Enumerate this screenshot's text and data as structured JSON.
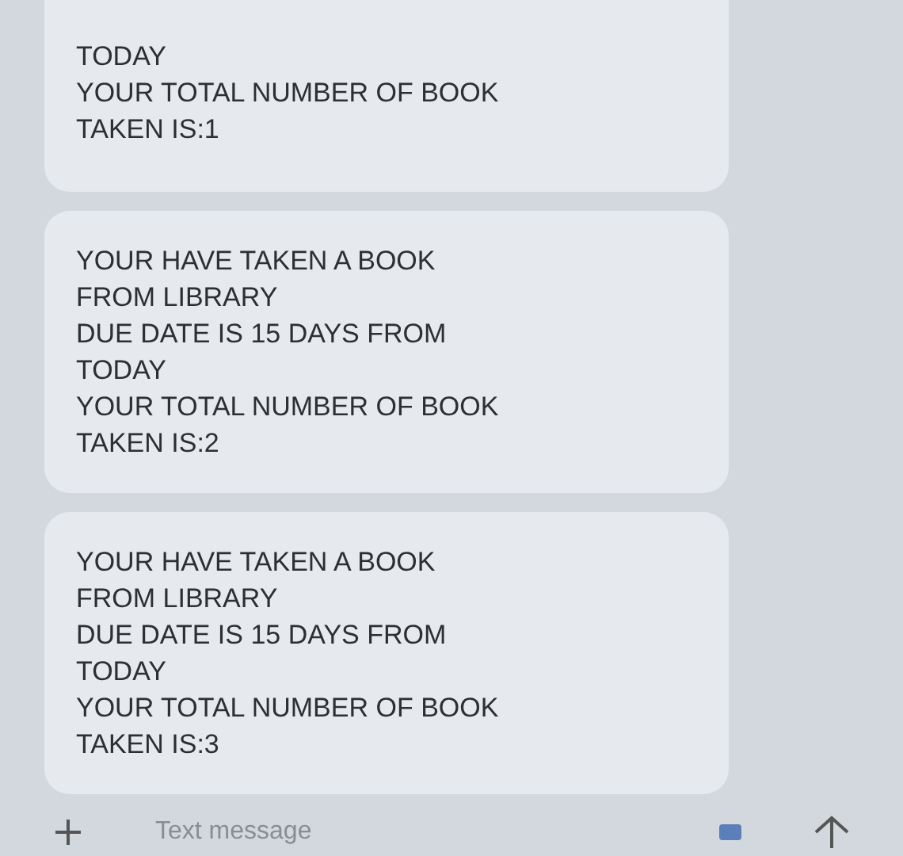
{
  "messages": [
    {
      "text": "TODAY\nYOUR TOTAL NUMBER OF BOOK\nTAKEN IS:1"
    },
    {
      "text": "YOUR HAVE TAKEN A BOOK\nFROM LIBRARY\nDUE DATE IS 15 DAYS FROM\nTODAY\nYOUR TOTAL NUMBER OF BOOK\nTAKEN IS:2"
    },
    {
      "text": "YOUR HAVE TAKEN A BOOK\nFROM LIBRARY\nDUE DATE IS 15 DAYS FROM\nTODAY\nYOUR TOTAL NUMBER OF BOOK\nTAKEN IS:3"
    }
  ],
  "composer": {
    "placeholder": "Text message"
  }
}
